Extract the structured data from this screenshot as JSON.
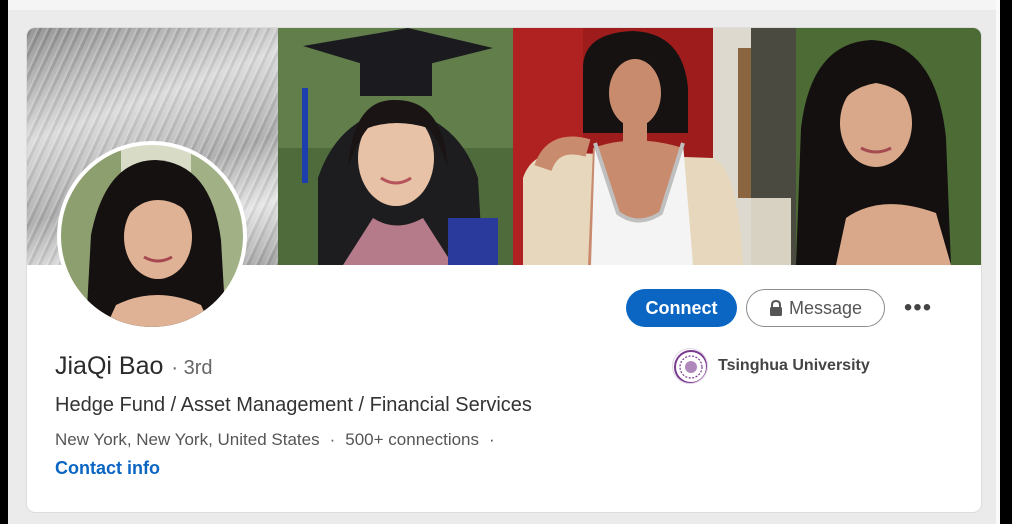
{
  "profile": {
    "name": "JiaQi Bao",
    "degree": "· 3rd",
    "headline": "Hedge Fund / Asset Management / Financial Services",
    "location": "New York, New York, United States",
    "sep1": "·",
    "connections": "500+ connections",
    "sep2": "·",
    "contact_info": "Contact info"
  },
  "actions": {
    "connect": "Connect",
    "message": "Message",
    "more": "•••"
  },
  "education": {
    "school": "Tsinghua University"
  },
  "colors": {
    "accent": "#0a66c2",
    "card_bg": "#ffffff",
    "page_bg": "#ebebeb"
  },
  "icons": [
    "lock-icon",
    "more-icon",
    "tsinghua-logo"
  ]
}
